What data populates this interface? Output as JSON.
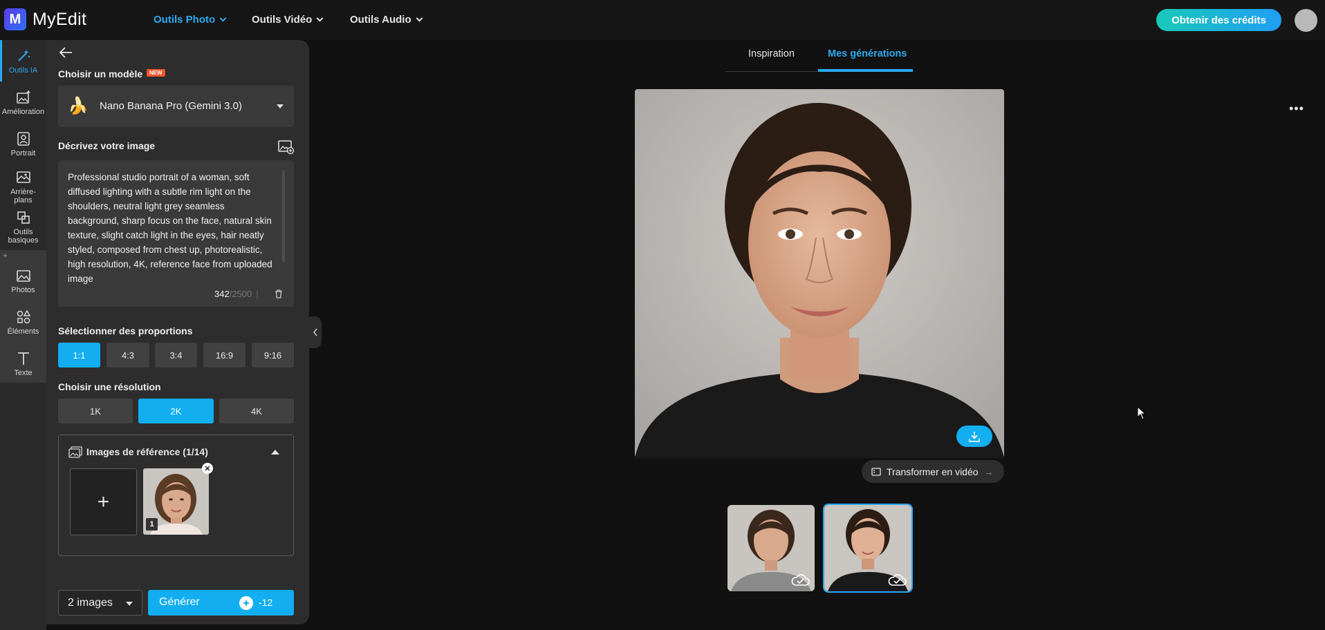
{
  "app": {
    "logo_letter": "M",
    "name": "MyEdit"
  },
  "nav": {
    "items": [
      {
        "label": "Outils Photo",
        "active": true
      },
      {
        "label": "Outils Vidéo",
        "active": false
      },
      {
        "label": "Outils Audio",
        "active": false
      }
    ],
    "credits_button": "Obtenir des crédits"
  },
  "rail": {
    "items": [
      {
        "label": "Outils IA",
        "icon": "magic-wand-icon",
        "active": true
      },
      {
        "label": "Amélioration",
        "icon": "image-enhance-icon"
      },
      {
        "label": "Portrait",
        "icon": "portrait-icon"
      },
      {
        "label": "Arrière-plans",
        "icon": "background-icon"
      },
      {
        "label": "Outils basiques",
        "icon": "basic-tools-icon"
      },
      {
        "label": "Photos",
        "icon": "photos-icon"
      },
      {
        "label": "Éléments",
        "icon": "elements-icon"
      },
      {
        "label": "Texte",
        "icon": "text-icon"
      }
    ],
    "plus": "+"
  },
  "panel": {
    "model_label": "Choisir un modèle",
    "new_badge": "NEW",
    "model_name": "Nano Banana Pro (Gemini 3.0)",
    "model_emoji": "🍌",
    "describe_label": "Décrivez votre image",
    "prompt": "Professional studio portrait of a woman, soft diffused lighting with a subtle rim light on the shoulders, neutral light grey seamless background, sharp focus on the face, natural skin texture, slight catch light in the eyes, hair neatly styled, composed from chest up, photorealistic, high resolution, 4K, reference face from uploaded image",
    "char_count": "342",
    "char_max": "/2500",
    "char_sep": "|",
    "proportions_label": "Sélectionner des proportions",
    "proportions": [
      "1:1",
      "4:3",
      "3:4",
      "16:9",
      "9:16"
    ],
    "proportion_selected": "1:1",
    "resolution_label": "Choisir une résolution",
    "resolutions": [
      "1K",
      "2K",
      "4K"
    ],
    "resolution_selected": "2K",
    "reference_title": "Images de référence (1/14)",
    "reference_count": "1",
    "add_symbol": "+",
    "close_symbol": "✕",
    "image_count": "2 images",
    "generate_label": "Générer",
    "generate_cost": "-12"
  },
  "main": {
    "tabs": [
      {
        "label": "Inspiration",
        "active": false
      },
      {
        "label": "Mes générations",
        "active": true
      }
    ],
    "more": "•••",
    "to_video": "Transformer en vidéo",
    "to_video_arrow": "→"
  },
  "colors": {
    "accent": "#12aef0",
    "background": "#111111",
    "panel": "#2d2d2d"
  }
}
